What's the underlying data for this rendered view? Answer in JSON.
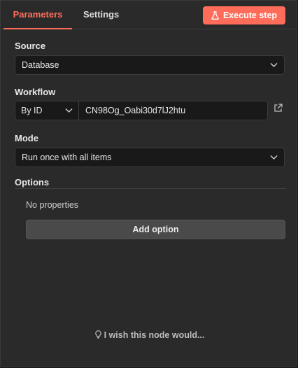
{
  "tabs": {
    "parameters": "Parameters",
    "settings": "Settings"
  },
  "execute_button": {
    "label": "Execute step",
    "icon": "flask-icon"
  },
  "source": {
    "label": "Source",
    "value": "Database"
  },
  "workflow": {
    "label": "Workflow",
    "mode_value": "By ID",
    "id_value": "CN98Og_Oabi30d7lJ2htu",
    "link_icon": "external-link-icon"
  },
  "mode": {
    "label": "Mode",
    "value": "Run once with all items"
  },
  "options": {
    "label": "Options",
    "empty_text": "No properties",
    "add_button": "Add option"
  },
  "feedback": {
    "text": "I wish this node would...",
    "icon": "lightbulb-icon"
  },
  "colors": {
    "accent": "#ff6d5a",
    "panel_bg": "#2a2a2a",
    "input_bg": "#191919"
  }
}
